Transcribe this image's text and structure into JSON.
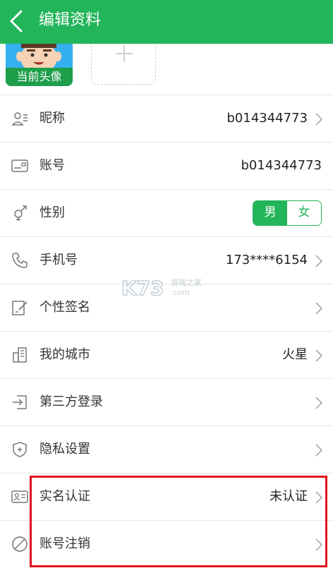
{
  "header": {
    "title": "编辑资料",
    "bg_color": "#22b55a"
  },
  "avatar": {
    "caption": "当前头像"
  },
  "rows": [
    {
      "icon": "user-card-icon",
      "label": "昵称",
      "value": "b014344773",
      "chevron": true
    },
    {
      "icon": "account-card-icon",
      "label": "账号",
      "value": "b014344773",
      "chevron": false
    },
    {
      "icon": "gender-icon",
      "label": "性别",
      "gender_options": [
        "男",
        "女"
      ],
      "selected": "男"
    },
    {
      "icon": "phone-icon",
      "label": "手机号",
      "value": "173****6154",
      "chevron": true
    },
    {
      "icon": "edit-signature-icon",
      "label": "个性签名",
      "value": "",
      "chevron": true
    },
    {
      "icon": "city-building-icon",
      "label": "我的城市",
      "value": "火星",
      "chevron": true
    },
    {
      "icon": "third-party-login-icon",
      "label": "第三方登录",
      "value": "",
      "chevron": true
    },
    {
      "icon": "privacy-shield-icon",
      "label": "隐私设置",
      "value": "",
      "chevron": true
    },
    {
      "icon": "id-card-icon",
      "label": "实名认证",
      "value": "未认证",
      "chevron": true
    },
    {
      "icon": "cancel-circle-icon",
      "label": "账号注销",
      "value": "",
      "chevron": true
    }
  ],
  "watermark": {
    "logo": "K73",
    "text": "游戏之家",
    "domain": ".com"
  },
  "colors": {
    "accent": "#22b55a",
    "highlight": "#e0131d"
  }
}
